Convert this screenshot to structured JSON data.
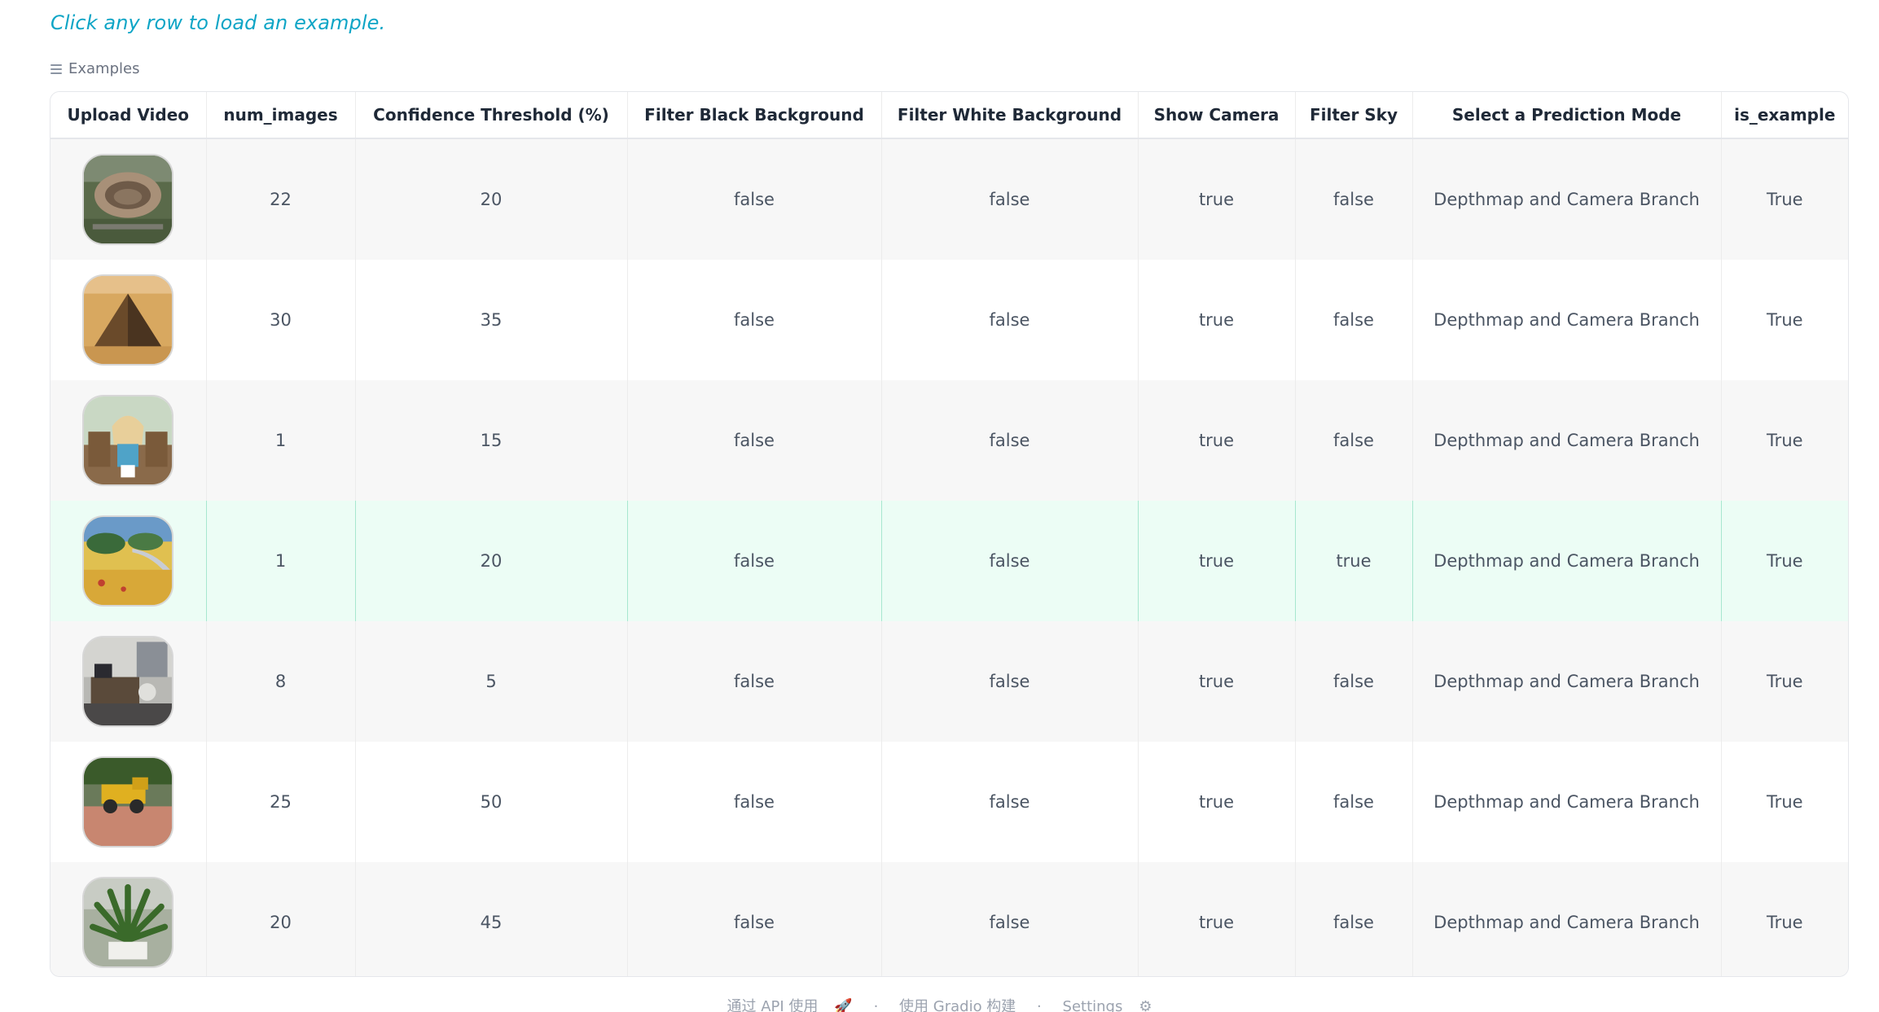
{
  "hint": "Click any row to load an example.",
  "examples_label": "Examples",
  "table": {
    "headers": [
      "Upload Video",
      "num_images",
      "Confidence Threshold (%)",
      "Filter Black Background",
      "Filter White Background",
      "Show Camera",
      "Filter Sky",
      "Select a Prediction Mode",
      "is_example"
    ],
    "rows": [
      {
        "thumb": "colosseum-thumbnail",
        "num_images": "22",
        "conf": "20",
        "filter_black": "false",
        "filter_white": "false",
        "show_camera": "true",
        "filter_sky": "false",
        "mode": "Depthmap and Camera Branch",
        "is_example": "True"
      },
      {
        "thumb": "pyramid-thumbnail",
        "num_images": "30",
        "conf": "35",
        "filter_black": "false",
        "filter_white": "false",
        "show_camera": "true",
        "filter_sky": "false",
        "mode": "Depthmap and Camera Branch",
        "is_example": "True"
      },
      {
        "thumb": "anime-girl-thumbnail",
        "num_images": "1",
        "conf": "15",
        "filter_black": "false",
        "filter_white": "false",
        "show_camera": "true",
        "filter_sky": "false",
        "mode": "Depthmap and Camera Branch",
        "is_example": "True"
      },
      {
        "thumb": "painting-landscape-thumbnail",
        "num_images": "1",
        "conf": "20",
        "filter_black": "false",
        "filter_white": "false",
        "show_camera": "true",
        "filter_sky": "true",
        "mode": "Depthmap and Camera Branch",
        "is_example": "True"
      },
      {
        "thumb": "room-interior-thumbnail",
        "num_images": "8",
        "conf": "5",
        "filter_black": "false",
        "filter_white": "false",
        "show_camera": "true",
        "filter_sky": "false",
        "mode": "Depthmap and Camera Branch",
        "is_example": "True"
      },
      {
        "thumb": "toy-truck-thumbnail",
        "num_images": "25",
        "conf": "50",
        "filter_black": "false",
        "filter_white": "false",
        "show_camera": "true",
        "filter_sky": "false",
        "mode": "Depthmap and Camera Branch",
        "is_example": "True"
      },
      {
        "thumb": "fern-plant-thumbnail",
        "num_images": "20",
        "conf": "45",
        "filter_black": "false",
        "filter_white": "false",
        "show_camera": "true",
        "filter_sky": "false",
        "mode": "Depthmap and Camera Branch",
        "is_example": "True"
      }
    ]
  },
  "footer": {
    "api": "通过 API 使用",
    "built": "使用 Gradio 构建",
    "settings": "Settings"
  },
  "colors": {
    "accent": "#0ea5c6",
    "highlight_row": "#ecfdf5"
  }
}
